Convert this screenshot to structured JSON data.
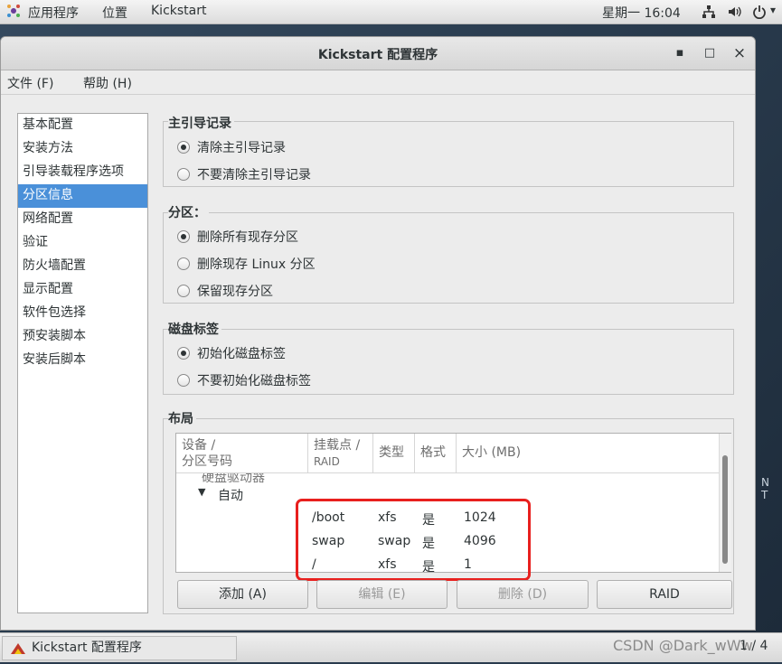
{
  "topbar": {
    "apps": "应用程序",
    "places": "位置",
    "active_app": "Kickstart",
    "clock": "星期一 16:04"
  },
  "window": {
    "title": "Kickstart 配置程序",
    "min": "▪",
    "max": "□",
    "close": "×"
  },
  "menu": {
    "file": "文件 (F)",
    "help": "帮助 (H)"
  },
  "sidebar": {
    "items": [
      "基本配置",
      "安装方法",
      "引导装载程序选项",
      "分区信息",
      "网络配置",
      "验证",
      "防火墙配置",
      "显示配置",
      "软件包选择",
      "预安装脚本",
      "安装后脚本"
    ],
    "selected": "分区信息"
  },
  "mbr": {
    "title": "主引导记录",
    "options": [
      "清除主引导记录",
      "不要清除主引导记录"
    ],
    "selected": "清除主引导记录"
  },
  "partitions": {
    "title": "分区：",
    "options": [
      "删除所有现存分区",
      "删除现存 Linux 分区",
      "保留现存分区"
    ],
    "selected": "删除所有现存分区"
  },
  "disklabel": {
    "title": "磁盘标签",
    "options": [
      "初始化磁盘标签",
      "不要初始化磁盘标签"
    ],
    "selected": "初始化磁盘标签"
  },
  "layout": {
    "title": "布局",
    "columns": [
      "设备 / 分区号码",
      "挂载点 / RAID",
      "类型",
      "格式",
      "大小 (MB)"
    ],
    "columns_lines": {
      "device": [
        "设备 /",
        "分区号码"
      ],
      "mount": [
        "挂载点 /",
        "RAID"
      ]
    },
    "partial_row": "硬盘驱动器",
    "group": "自动",
    "rows": [
      {
        "mount": "/boot",
        "type": "xfs",
        "format": "是",
        "size": "1024"
      },
      {
        "mount": "swap",
        "type": "swap",
        "format": "是",
        "size": "4096"
      },
      {
        "mount": "/",
        "type": "xfs",
        "format": "是",
        "size": "1"
      }
    ]
  },
  "buttons": {
    "add": "添加 (A)",
    "edit": "编辑 (E)",
    "delete": "删除 (D)",
    "raid": "RAID"
  },
  "taskbar": {
    "task": "Kickstart 配置程序",
    "watermark": "CSDN @Dark_wWw",
    "pager": "1 / 4"
  },
  "desktop": {
    "deco": "N T"
  }
}
